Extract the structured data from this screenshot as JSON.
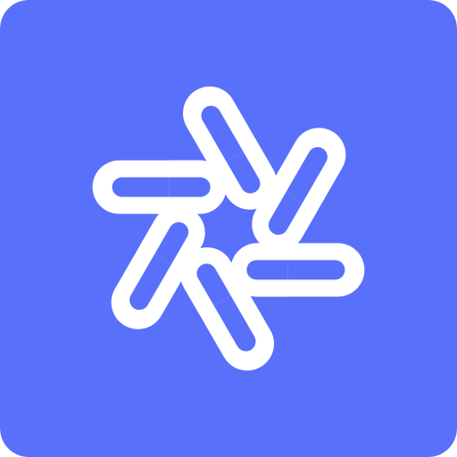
{
  "icon": {
    "name": "interlocking-loops-flower-logo",
    "background_color": "#5970FB",
    "foreground_color": "#FFFFFF",
    "petal_count": 6
  }
}
